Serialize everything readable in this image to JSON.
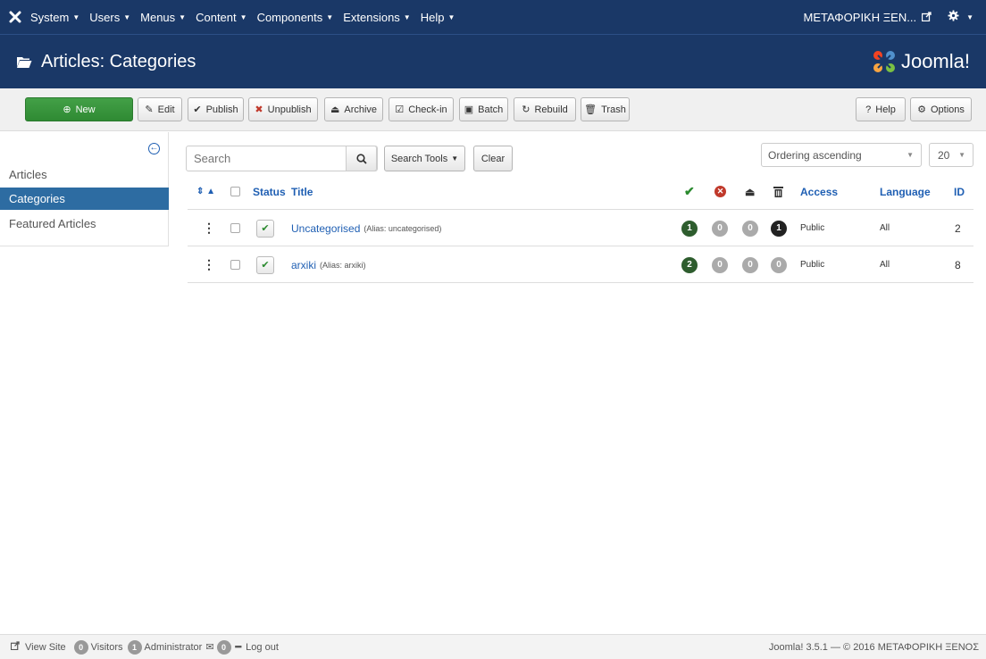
{
  "topbar": {
    "menu": [
      {
        "label": "System"
      },
      {
        "label": "Users"
      },
      {
        "label": "Menus"
      },
      {
        "label": "Content"
      },
      {
        "label": "Components"
      },
      {
        "label": "Extensions"
      },
      {
        "label": "Help"
      }
    ],
    "site_name": "ΜΕΤΑΦΟΡΙΚΗ ΞΕΝ...",
    "icons": {
      "logo": "joomla-x-icon",
      "external": "external-link-icon",
      "settings": "gear-icon"
    }
  },
  "header": {
    "title": "Articles: Categories",
    "brand": "Joomla!",
    "brand_colors": [
      "#f9a541",
      "#f44321",
      "#5091cd",
      "#7ac143"
    ]
  },
  "toolbar": {
    "new": "New",
    "edit": "Edit",
    "publish": "Publish",
    "unpublish": "Unpublish",
    "archive": "Archive",
    "checkin": "Check-in",
    "batch": "Batch",
    "rebuild": "Rebuild",
    "trash": "Trash",
    "help": "Help",
    "options": "Options"
  },
  "sidebar": {
    "items": [
      {
        "label": "Articles"
      },
      {
        "label": "Categories"
      },
      {
        "label": "Featured Articles"
      }
    ]
  },
  "filters": {
    "search_placeholder": "Search",
    "search_tools": "Search Tools",
    "clear": "Clear",
    "ordering": "Ordering ascending",
    "limit": "20"
  },
  "table": {
    "headers": {
      "status": "Status",
      "title": "Title",
      "access": "Access",
      "language": "Language",
      "id": "ID"
    },
    "rows": [
      {
        "title": "Uncategorised",
        "alias": "(Alias: uncategorised)",
        "published": "1",
        "unpublished": "0",
        "archived": "0",
        "trashed": "1",
        "access": "Public",
        "language": "All",
        "id": "2"
      },
      {
        "title": "arxiki",
        "alias": "(Alias: arxiki)",
        "published": "2",
        "unpublished": "0",
        "archived": "0",
        "trashed": "0",
        "access": "Public",
        "language": "All",
        "id": "8"
      }
    ]
  },
  "footer": {
    "view_site": "View Site",
    "visitors_count": "0",
    "visitors": "Visitors",
    "admin_count": "1",
    "administrator": "Administrator",
    "messages_count": "0",
    "logout": "Log out",
    "copyright": "Joomla! 3.5.1 — © 2016 ΜΕΤΑΦΟΡΙΚΗ ΞΕΝΟΣ"
  }
}
